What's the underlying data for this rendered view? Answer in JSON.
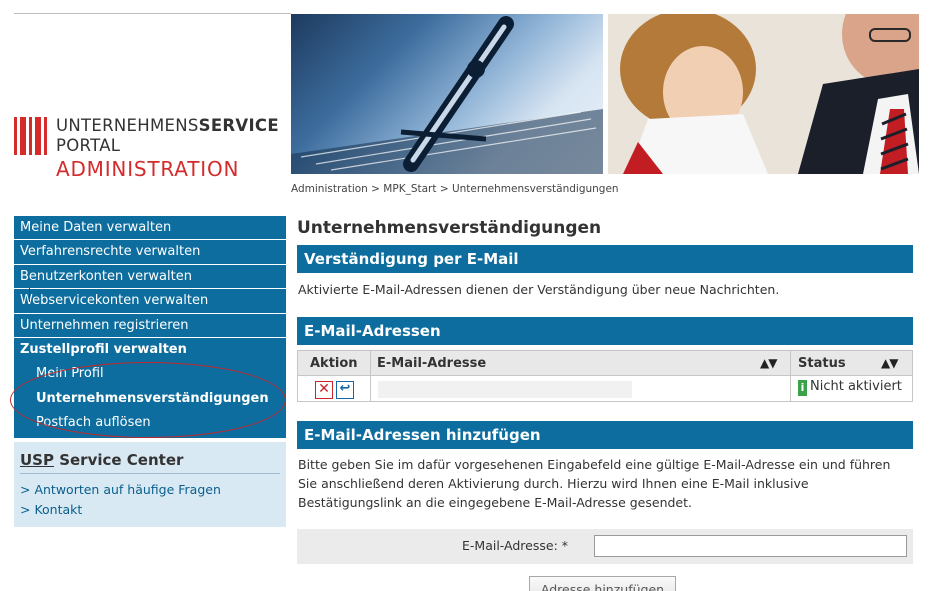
{
  "logo": {
    "line1_regular": "UNTERNEHMENS",
    "line1_bold": "SERVICE",
    "line2": "PORTAL",
    "line3": "ADMINISTRATION",
    "brand_color": "#d42b2b"
  },
  "breadcrumb": "Administration > MPK_Start > Unternehmensverständigungen",
  "nav": {
    "items": [
      {
        "label": "Meine Daten verwalten"
      },
      {
        "label": "Verfahrensrechte verwalten"
      },
      {
        "label": "Benutzerkonten verwalten"
      },
      {
        "label": "Webservicekonten verwalten"
      },
      {
        "label": "Unternehmen registrieren"
      },
      {
        "label": "Zustellprofil verwalten"
      }
    ],
    "subitems": [
      {
        "label": "Mein Profil"
      },
      {
        "label": "Unternehmensverständigungen"
      },
      {
        "label": "Postfach auflösen"
      }
    ],
    "color": "#0c6d9e"
  },
  "service_center": {
    "title_prefix": "USP",
    "title_rest": " Service Center",
    "links": [
      "> Antworten auf häufige Fragen",
      "> Kontakt"
    ]
  },
  "main": {
    "title": "Unternehmensverständigungen",
    "section1": {
      "heading": "Verständigung per E-Mail",
      "text": "Aktivierte E-Mail-Adressen dienen der Verständigung über neue Nachrichten."
    },
    "section2": {
      "heading": "E-Mail-Adressen",
      "columns": [
        "Aktion",
        "E-Mail-Adresse",
        "Status"
      ],
      "sort_glyph": "▲▼",
      "rows": [
        {
          "status": "Nicht aktiviert",
          "status_icon": "i"
        }
      ]
    },
    "section3": {
      "heading": "E-Mail-Adressen hinzufügen",
      "text": "Bitte geben Sie im dafür vorgesehenen Eingabefeld eine gültige E-Mail-Adresse ein und führen Sie anschließend deren Aktivierung durch. Hierzu wird Ihnen eine E-Mail inklusive Bestätigungslink an die eingegebene E-Mail-Adresse gesendet.",
      "field_label": "E-Mail-Adresse: *",
      "field_value": "",
      "button": "Adresse hinzufügen"
    }
  }
}
